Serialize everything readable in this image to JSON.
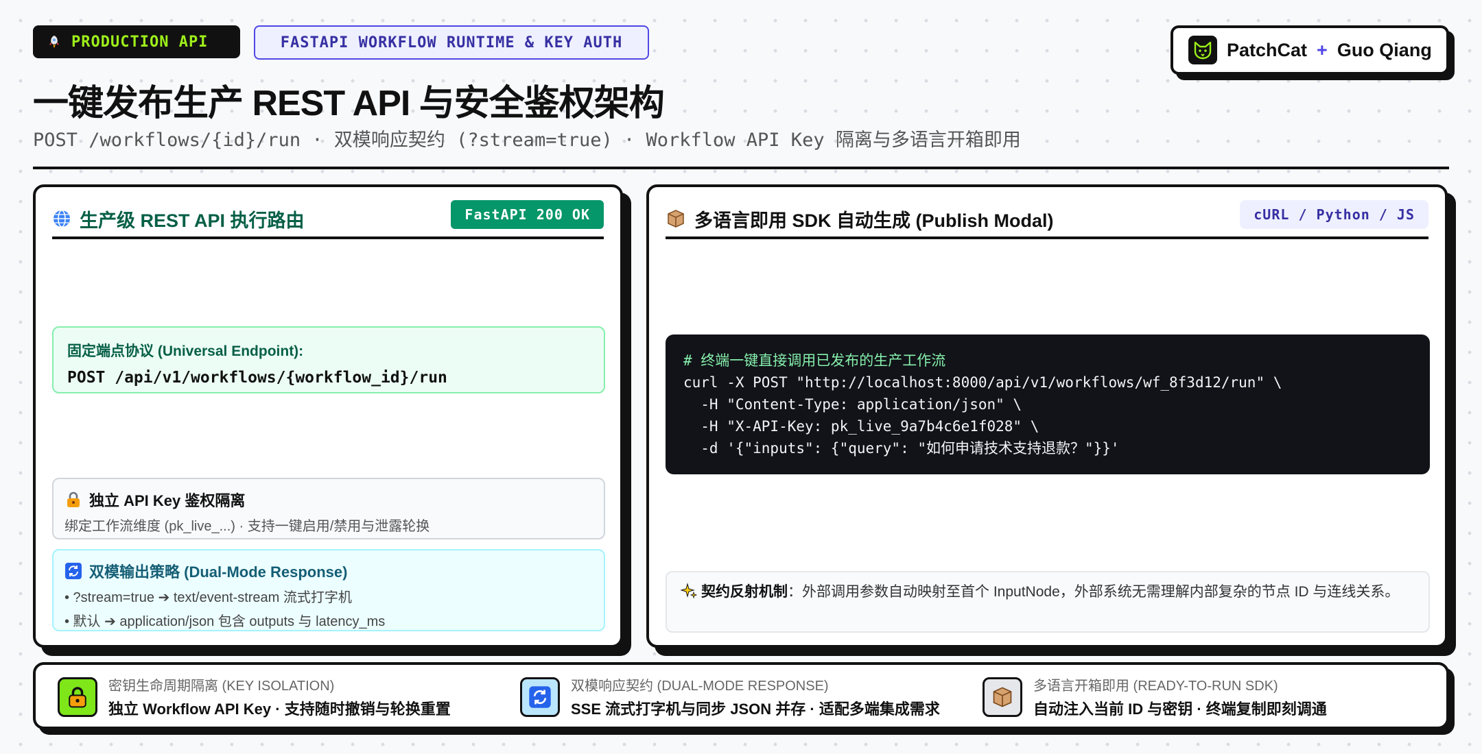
{
  "header": {
    "tag_primary": "PRODUCTION API",
    "tag_primary_icon": "rocket-icon",
    "tag_secondary": "FASTAPI WORKFLOW RUNTIME & KEY AUTH",
    "brand_name": "PatchCat",
    "brand_plus": "+",
    "brand_partner": "Guo Qiang",
    "title": "一键发布生产 REST API 与安全鉴权架构",
    "subtitle": "POST /workflows/{id}/run · 双模响应契约 (?stream=true) · Workflow API Key 隔离与多语言开箱即用"
  },
  "left_panel": {
    "title": "生产级 REST API 执行路由",
    "title_icon": "globe-icon",
    "badge": "FastAPI 200 OK",
    "endpoint_label": "固定端点协议 (Universal Endpoint):",
    "endpoint_value": "POST /api/v1/workflows/{workflow_id}/run",
    "key_card": {
      "title": "独立 API Key 鉴权隔离",
      "icon": "lock-icon",
      "desc": "绑定工作流维度 (pk_live_...) · 支持一键启用/禁用与泄露轮换"
    },
    "dual_card": {
      "title": "双模输出策略 (Dual-Mode Response)",
      "icon": "refresh-icon",
      "line1": "• ?stream=true ➔ text/event-stream 流式打字机",
      "line2": "• 默认 ➔ application/json 包含 outputs 与 latency_ms"
    }
  },
  "right_panel": {
    "title": "多语言即用 SDK 自动生成 (Publish Modal)",
    "title_icon": "package-icon",
    "badge": "cURL / Python / JS",
    "code": {
      "comment": "# 终端一键直接调用已发布的生产工作流",
      "line1": "curl -X POST \"http://localhost:8000/api/v1/workflows/wf_8f3d12/run\" \\",
      "line2": "  -H \"Content-Type: application/json\" \\",
      "line3": "  -H \"X-API-Key: pk_live_9a7b4c6e1f028\" \\",
      "line4": "  -d '{\"inputs\": {\"query\": \"如何申请技术支持退款？\"}}'"
    },
    "note": {
      "icon": "sparkle-icon",
      "label": "契约反射机制",
      "text": "：外部调用参数自动映射至首个 InputNode，外部系统无需理解内部复杂的节点 ID 与连线关系。"
    }
  },
  "footer": {
    "items": [
      {
        "icon": "lock-icon",
        "label": "密钥生命周期隔离 (KEY ISOLATION)",
        "text": "独立 Workflow API Key · 支持随时撤销与轮换重置"
      },
      {
        "icon": "refresh-icon",
        "label": "双模响应契约 (DUAL-MODE RESPONSE)",
        "text": "SSE 流式打字机与同步 JSON 并存 · 适配多端集成需求"
      },
      {
        "icon": "package-icon",
        "label": "多语言开箱即用 (READY-TO-RUN SDK)",
        "text": "自动注入当前 ID 与密钥 · 终端复制即刻调通"
      }
    ]
  },
  "colors": {
    "accent_green": "#059669",
    "accent_indigo": "#4f46e5",
    "lime": "#9ef01a",
    "code_bg": "#111318"
  }
}
